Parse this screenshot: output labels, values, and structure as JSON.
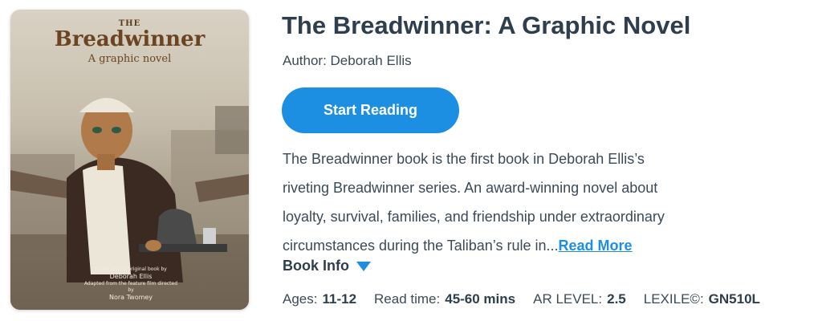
{
  "cover": {
    "the": "THE",
    "title": "Breadwinner",
    "subtitle": "A graphic novel",
    "credit_1": "Based on the original book by",
    "credit_author": "Deborah Ellis",
    "credit_2": "Adapted from the feature film directed by",
    "credit_director": "Nora Twomey"
  },
  "book": {
    "title": "The Breadwinner: A Graphic Novel",
    "author": "Author: Deborah Ellis",
    "start_label": "Start Reading",
    "description_lines": [
      "The Breadwinner book is the first book in Deborah Ellis’s",
      "riveting Breadwinner series. An award-winning novel about",
      "loyalty, survival, families, and friendship under extraordinary",
      "circumstances during the Taliban’s rule in..."
    ],
    "read_more": "Read More",
    "info_label": "Book Info"
  },
  "meta": {
    "ages_label": "Ages:",
    "ages_value": "11-12",
    "read_time_label": "Read time:",
    "read_time_value": "45-60 mins",
    "ar_label": "AR LEVEL:",
    "ar_value": "2.5",
    "lexile_label": "LEXILE©:",
    "lexile_value": "GN510L"
  },
  "colors": {
    "accent": "#1d8fe3",
    "title_text": "#2f3e4e"
  }
}
